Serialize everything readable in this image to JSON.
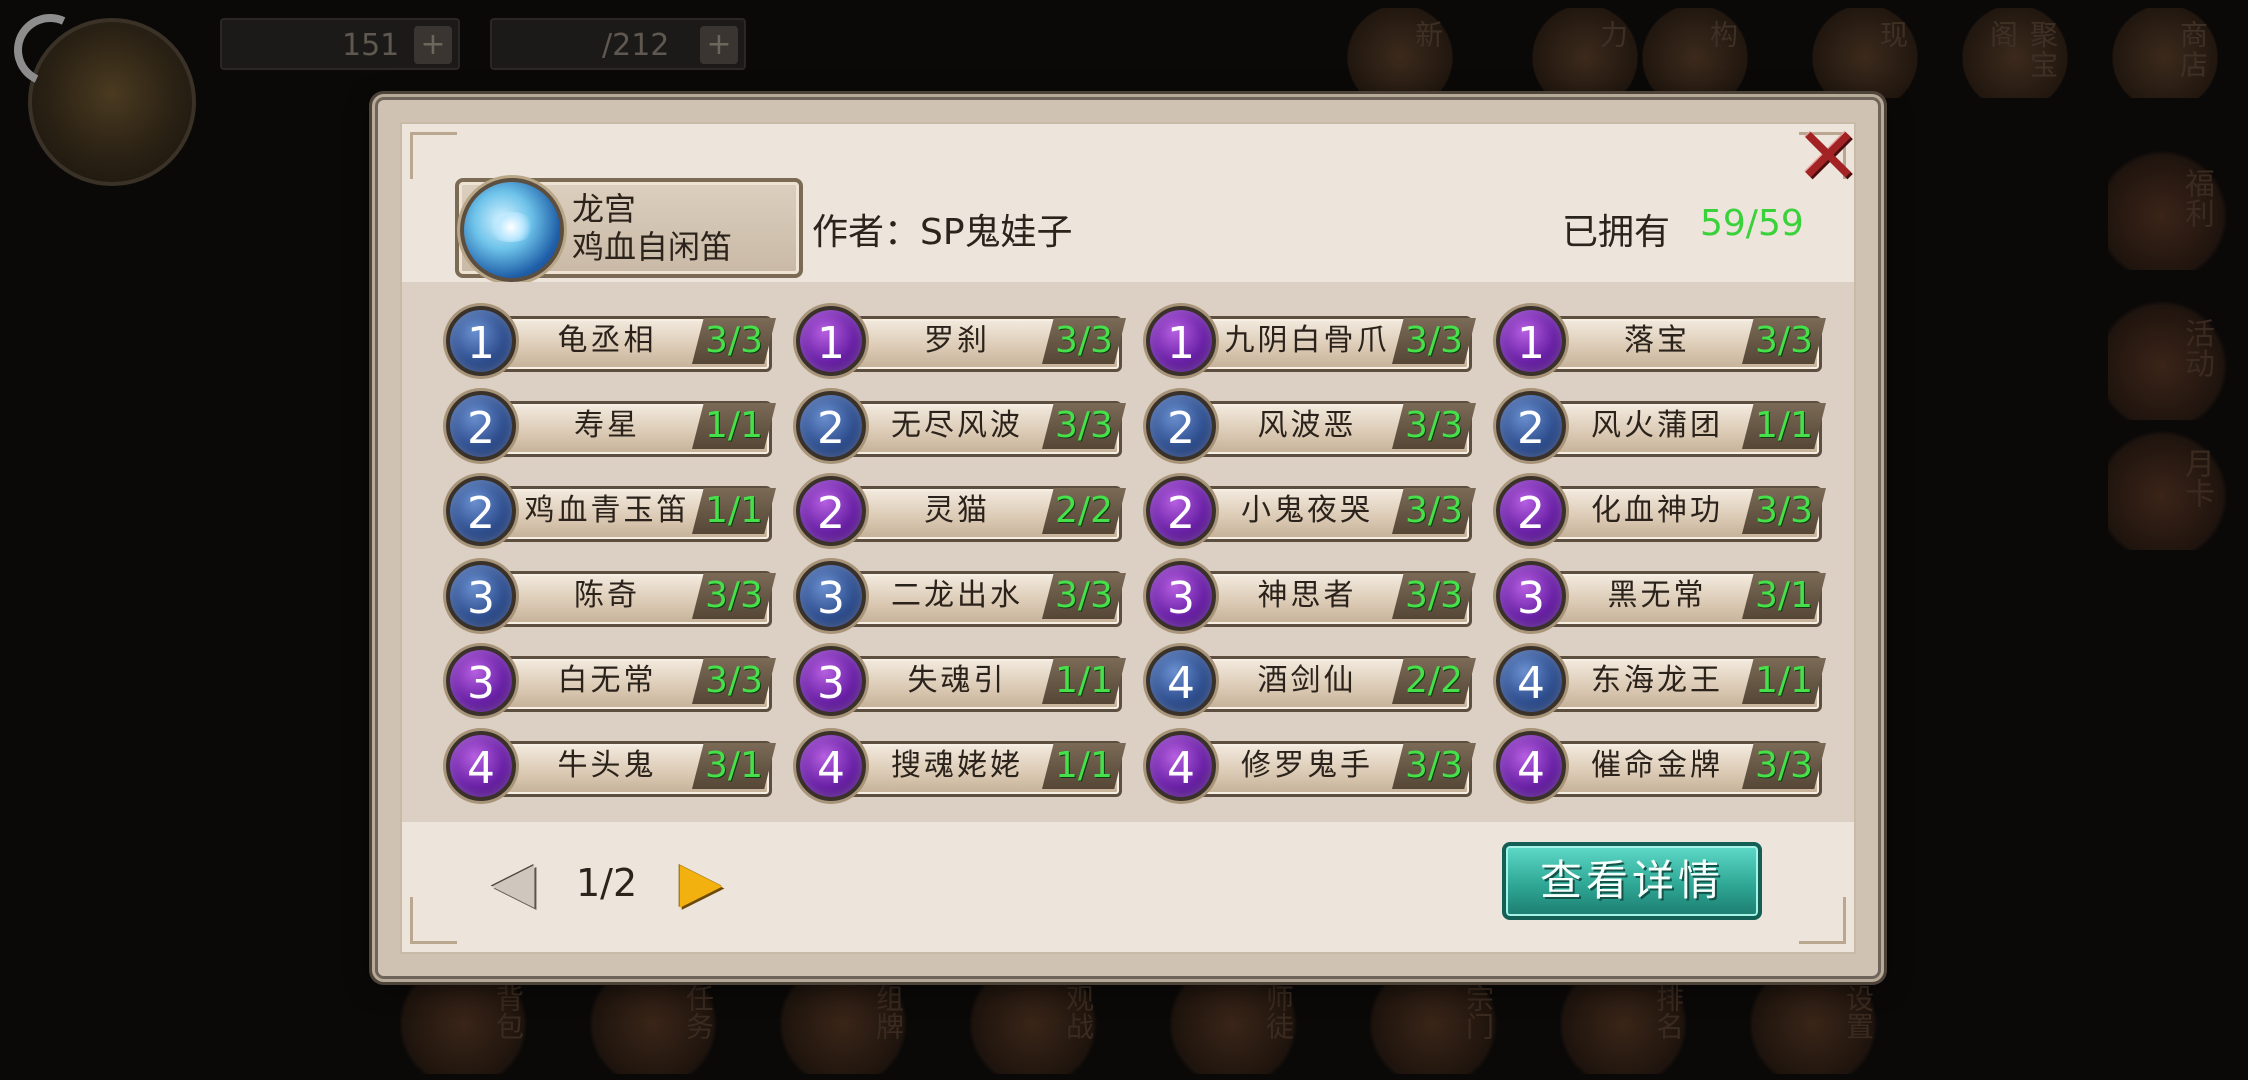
{
  "background": {
    "resources": [
      {
        "value": "151"
      },
      {
        "value": "/212"
      }
    ],
    "top_icons": [
      "新",
      "力",
      "构",
      "现",
      "聚宝阁",
      "商店"
    ],
    "side_icons": [
      "福利",
      "活动",
      "月卡"
    ],
    "bottom_icons": [
      "背包",
      "任务",
      "组牌",
      "观战",
      "师徒",
      "宗门",
      "排名",
      "设置"
    ]
  },
  "dialog": {
    "deck": {
      "line1": "龙宫",
      "line2": "鸡血自闲笛"
    },
    "author": "作者：SP鬼娃子",
    "owned_label": "已拥有",
    "owned_count": "59/59",
    "close_icon": "close-x-icon",
    "cards": [
      {
        "cost": "1",
        "color": "blue",
        "name": "龟丞相",
        "qty": "3/3"
      },
      {
        "cost": "1",
        "color": "purple",
        "name": "罗刹",
        "qty": "3/3"
      },
      {
        "cost": "1",
        "color": "purple",
        "name": "九阴白骨爪",
        "qty": "3/3"
      },
      {
        "cost": "1",
        "color": "purple",
        "name": "落宝",
        "qty": "3/3"
      },
      {
        "cost": "2",
        "color": "blue",
        "name": "寿星",
        "qty": "1/1"
      },
      {
        "cost": "2",
        "color": "blue",
        "name": "无尽风波",
        "qty": "3/3"
      },
      {
        "cost": "2",
        "color": "blue",
        "name": "风波恶",
        "qty": "3/3"
      },
      {
        "cost": "2",
        "color": "blue",
        "name": "风火蒲团",
        "qty": "1/1"
      },
      {
        "cost": "2",
        "color": "blue",
        "name": "鸡血青玉笛",
        "qty": "1/1"
      },
      {
        "cost": "2",
        "color": "purple",
        "name": "灵猫",
        "qty": "2/2"
      },
      {
        "cost": "2",
        "color": "purple",
        "name": "小鬼夜哭",
        "qty": "3/3"
      },
      {
        "cost": "2",
        "color": "purple",
        "name": "化血神功",
        "qty": "3/3"
      },
      {
        "cost": "3",
        "color": "blue",
        "name": "陈奇",
        "qty": "3/3"
      },
      {
        "cost": "3",
        "color": "blue",
        "name": "二龙出水",
        "qty": "3/3"
      },
      {
        "cost": "3",
        "color": "purple",
        "name": "神思者",
        "qty": "3/3"
      },
      {
        "cost": "3",
        "color": "purple",
        "name": "黑无常",
        "qty": "3/1"
      },
      {
        "cost": "3",
        "color": "purple",
        "name": "白无常",
        "qty": "3/3"
      },
      {
        "cost": "3",
        "color": "purple",
        "name": "失魂引",
        "qty": "1/1"
      },
      {
        "cost": "4",
        "color": "blue",
        "name": "酒剑仙",
        "qty": "2/2"
      },
      {
        "cost": "4",
        "color": "blue",
        "name": "东海龙王",
        "qty": "1/1"
      },
      {
        "cost": "4",
        "color": "purple",
        "name": "牛头鬼",
        "qty": "3/1"
      },
      {
        "cost": "4",
        "color": "purple",
        "name": "搜魂姥姥",
        "qty": "1/1"
      },
      {
        "cost": "4",
        "color": "purple",
        "name": "修罗鬼手",
        "qty": "3/3"
      },
      {
        "cost": "4",
        "color": "purple",
        "name": "催命金牌",
        "qty": "3/3"
      }
    ],
    "pagination": {
      "current": "1/2",
      "prev_icon": "chevron-left-icon",
      "next_icon": "chevron-right-icon"
    },
    "detail_button": "查看详情"
  },
  "colors": {
    "owned_green": "#39d23a",
    "cost_blue": "#2f4f8f",
    "cost_purple": "#6a21a6",
    "detail_teal": "#2fa896",
    "close_red": "#a32223"
  }
}
